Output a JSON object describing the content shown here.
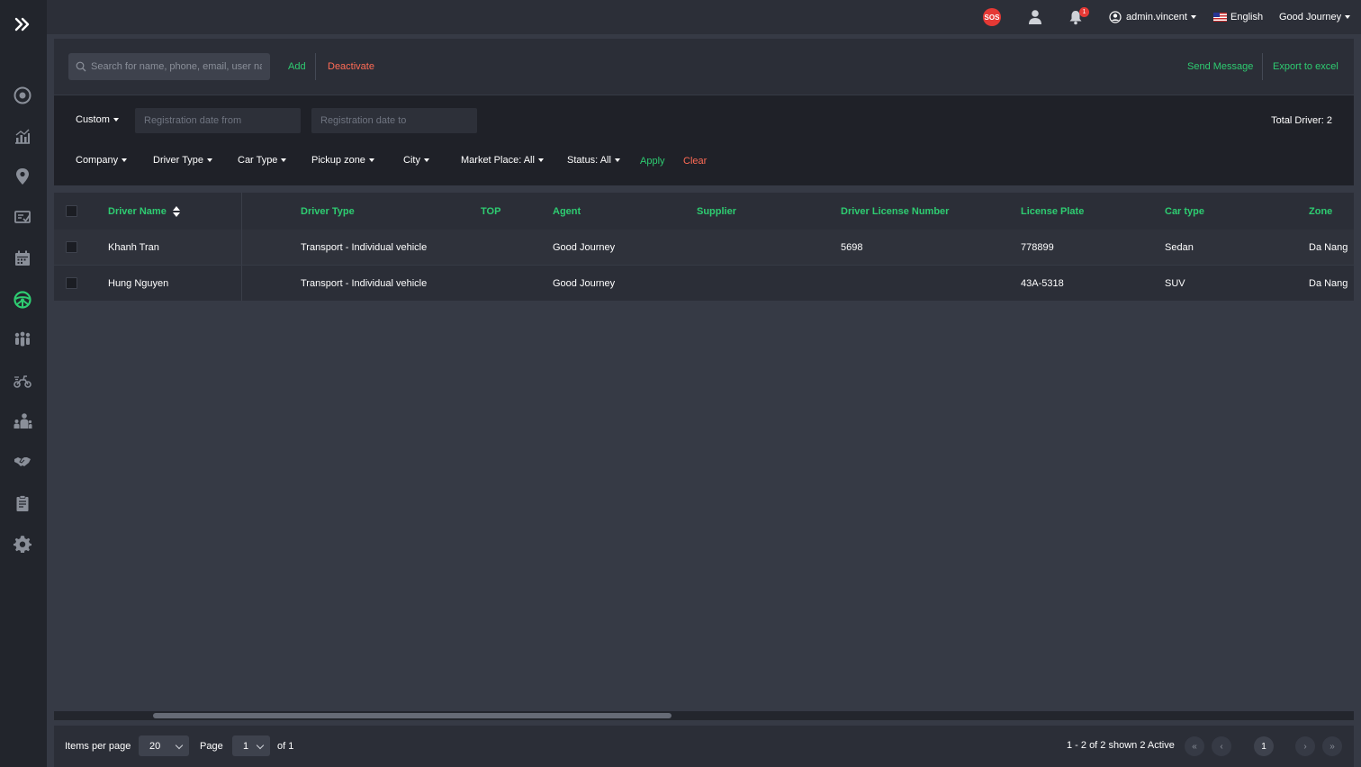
{
  "topbar": {
    "sos_label": "SOS",
    "notification_count": "1",
    "user": "admin.vincent",
    "language": "English",
    "company": "Good Journey"
  },
  "toolbar": {
    "search_placeholder": "Search for name, phone, email, user name",
    "add": "Add",
    "deactivate": "Deactivate",
    "send_message": "Send Message",
    "export": "Export to excel"
  },
  "filters": {
    "date_mode": "Custom",
    "date_from_placeholder": "Registration date from",
    "date_to_placeholder": "Registration date to",
    "total": "Total Driver: 2",
    "dropdowns": [
      "Company",
      "Driver Type",
      "Car Type",
      "Pickup zone",
      "City",
      "Market Place: All",
      "Status: All"
    ],
    "apply": "Apply",
    "clear": "Clear"
  },
  "table": {
    "columns": [
      "Driver Name",
      "Driver Type",
      "TOP",
      "Agent",
      "Supplier",
      "Driver License Number",
      "License Plate",
      "Car type",
      "Zone"
    ],
    "rows": [
      [
        "Khanh Tran",
        "Transport - Individual vehicle",
        "",
        "Good Journey",
        "",
        "5698",
        "778899",
        "Sedan",
        "Da Nang"
      ],
      [
        "Hung Nguyen",
        "Transport - Individual vehicle",
        "",
        "Good Journey",
        "",
        "",
        "43A-5318",
        "SUV",
        "Da Nang"
      ]
    ]
  },
  "footer": {
    "items_per_page_label": "Items per page",
    "items_per_page": "20",
    "page_label": "Page",
    "page": "1",
    "of": "of 1",
    "summary": "1 - 2 of 2 shown 2 Active",
    "current_page": "1",
    "first": "«",
    "prev": "‹",
    "next": "›",
    "last": "»"
  },
  "sidebar": {
    "icons": [
      "dashboard-icon",
      "analytics-icon",
      "map-pin-icon",
      "booking-icon",
      "calendar-icon",
      "steering-wheel-icon",
      "passengers-icon",
      "motorbike-icon",
      "staff-icon",
      "handshake-icon",
      "clipboard-icon",
      "settings-icon"
    ],
    "active": "steering-wheel-icon"
  },
  "colors": {
    "accent": "#2ecc71",
    "danger": "#ff6b55",
    "background": "#363a45",
    "sidebar": "#22252c"
  }
}
